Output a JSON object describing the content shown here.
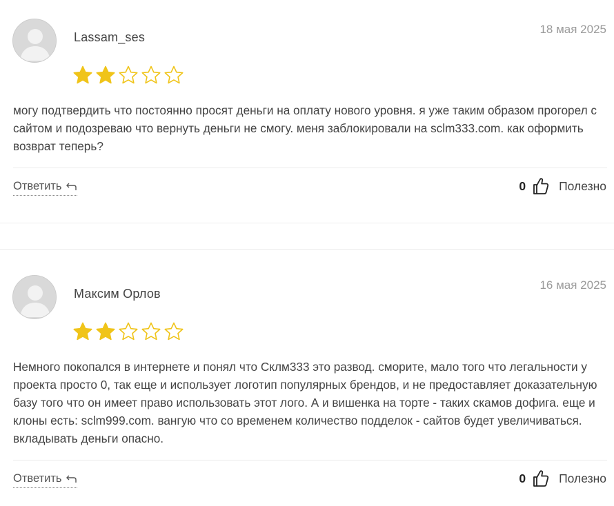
{
  "colors": {
    "star_filled": "#f0c419",
    "star_outline": "#f0c419",
    "date": "#9a9a9a",
    "text": "#444444",
    "avatar_bg": "#d9d9d9"
  },
  "reviews": [
    {
      "author": "Lassam_ses",
      "date": "18 мая 2025",
      "rating": 2,
      "rating_max": 5,
      "text": "могу подтвердить что постоянно просят деньги на оплату нового уровня. я уже таким образом прогорел с сайтом и подозреваю что вернуть деньги не смогу. меня заблокировали на sclm333.com. как оформить возврат теперь?",
      "reply_label": "Ответить",
      "helpful_count": "0",
      "helpful_label": "Полезно"
    },
    {
      "author": "Максим Орлов",
      "date": "16 мая 2025",
      "rating": 2,
      "rating_max": 5,
      "text": "Немного покопался в интернете и понял что Склм333 это развод. сморите, мало того что легальности у проекта просто 0, так еще и использует логотип популярных брендов, и не предоставляет доказательную базу того что он имеет право использовать этот лого. А и вишенка на торте - таких скамов дофига. еще и клоны есть: sclm999.com. вангую что со временем количество подделок - сайтов будет увеличиваться. вкладывать деньги опасно.",
      "reply_label": "Ответить",
      "helpful_count": "0",
      "helpful_label": "Полезно"
    }
  ],
  "icons": {
    "avatar": "user-silhouette-icon",
    "star": "star-icon",
    "reply": "reply-arrow-icon",
    "thumb": "thumbs-up-icon"
  }
}
